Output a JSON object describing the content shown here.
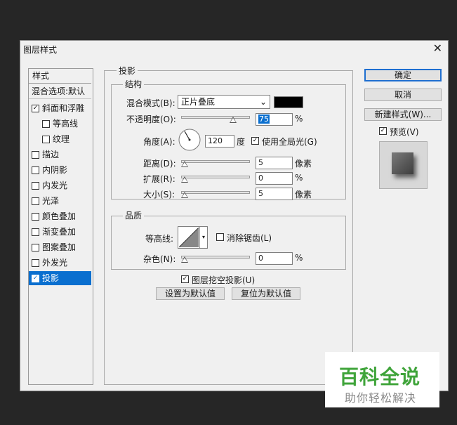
{
  "window": {
    "title": "图层样式",
    "close_label": "✕"
  },
  "left_panel": {
    "header": "样式",
    "items": [
      {
        "label": "混合选项:默认",
        "checkbox": false,
        "checked": false
      },
      {
        "label": "斜面和浮雕",
        "checkbox": true,
        "checked": true
      },
      {
        "label": "等高线",
        "checkbox": true,
        "checked": false,
        "indent": true
      },
      {
        "label": "纹理",
        "checkbox": true,
        "checked": false,
        "indent": true
      },
      {
        "label": "描边",
        "checkbox": true,
        "checked": false
      },
      {
        "label": "内阴影",
        "checkbox": true,
        "checked": false
      },
      {
        "label": "内发光",
        "checkbox": true,
        "checked": false
      },
      {
        "label": "光泽",
        "checkbox": true,
        "checked": false
      },
      {
        "label": "颜色叠加",
        "checkbox": true,
        "checked": false
      },
      {
        "label": "渐变叠加",
        "checkbox": true,
        "checked": false
      },
      {
        "label": "图案叠加",
        "checkbox": true,
        "checked": false
      },
      {
        "label": "外发光",
        "checkbox": true,
        "checked": false
      },
      {
        "label": "投影",
        "checkbox": true,
        "checked": true,
        "selected": true
      }
    ]
  },
  "section": {
    "title": "投影",
    "structure": {
      "title": "结构",
      "blend_mode_label": "混合模式(B):",
      "blend_mode_value": "正片叠底",
      "blend_color": "#000000",
      "opacity_label": "不透明度(O):",
      "opacity_value": "75",
      "opacity_fraction": 0.75,
      "percent": "%",
      "angle_label": "角度(A):",
      "angle_value": "120",
      "angle_unit": "度",
      "global_light_label": "使用全局光(G)",
      "global_light_checked": true,
      "distance_label": "距离(D):",
      "distance_value": "5",
      "spread_label": "扩展(R):",
      "spread_value": "0",
      "size_label": "大小(S):",
      "size_value": "5",
      "pixels_unit": "像素"
    },
    "quality": {
      "title": "品质",
      "contour_label": "等高线:",
      "antialias_label": "消除锯齿(L)",
      "antialias_checked": false,
      "noise_label": "杂色(N):",
      "noise_value": "0",
      "percent": "%"
    },
    "knockout_label": "图层挖空投影(U)",
    "knockout_checked": true,
    "make_default_label": "设置为默认值",
    "reset_default_label": "复位为默认值"
  },
  "buttons": {
    "ok": "确定",
    "cancel": "取消",
    "new_style": "新建样式(W)...",
    "preview_label": "预览(V)",
    "preview_checked": true
  },
  "watermark": {
    "title": "百科全说",
    "subtitle": "助你轻松解决",
    "color": "#3fa43a"
  }
}
